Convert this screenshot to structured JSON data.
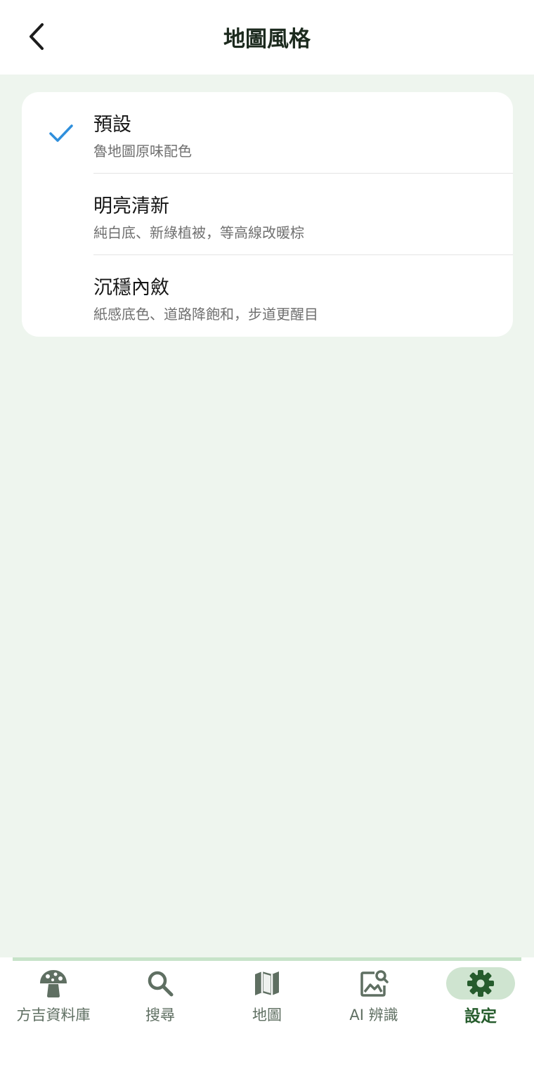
{
  "header": {
    "title": "地圖風格",
    "back_icon": "chevron-left-icon"
  },
  "options": [
    {
      "title": "預設",
      "subtitle": "魯地圖原味配色",
      "selected": true
    },
    {
      "title": "明亮清新",
      "subtitle": "純白底、新綠植被，等高線改暖棕",
      "selected": false
    },
    {
      "title": "沉穩內斂",
      "subtitle": "紙感底色、道路降飽和，步道更醒目",
      "selected": false
    }
  ],
  "nav": {
    "items": [
      {
        "label": "方吉資料庫",
        "icon": "mushroom-icon",
        "active": false
      },
      {
        "label": "搜尋",
        "icon": "search-icon",
        "active": false
      },
      {
        "label": "地圖",
        "icon": "map-icon",
        "active": false
      },
      {
        "label": "AI 辨識",
        "icon": "image-search-icon",
        "active": false
      },
      {
        "label": "設定",
        "icon": "gear-icon",
        "active": true
      }
    ]
  },
  "colors": {
    "background": "#eef5ee",
    "check": "#2f8fdc",
    "active_nav": "#265c2d",
    "active_pill": "#cfe4d0",
    "nav_icon": "#5f6f62"
  }
}
